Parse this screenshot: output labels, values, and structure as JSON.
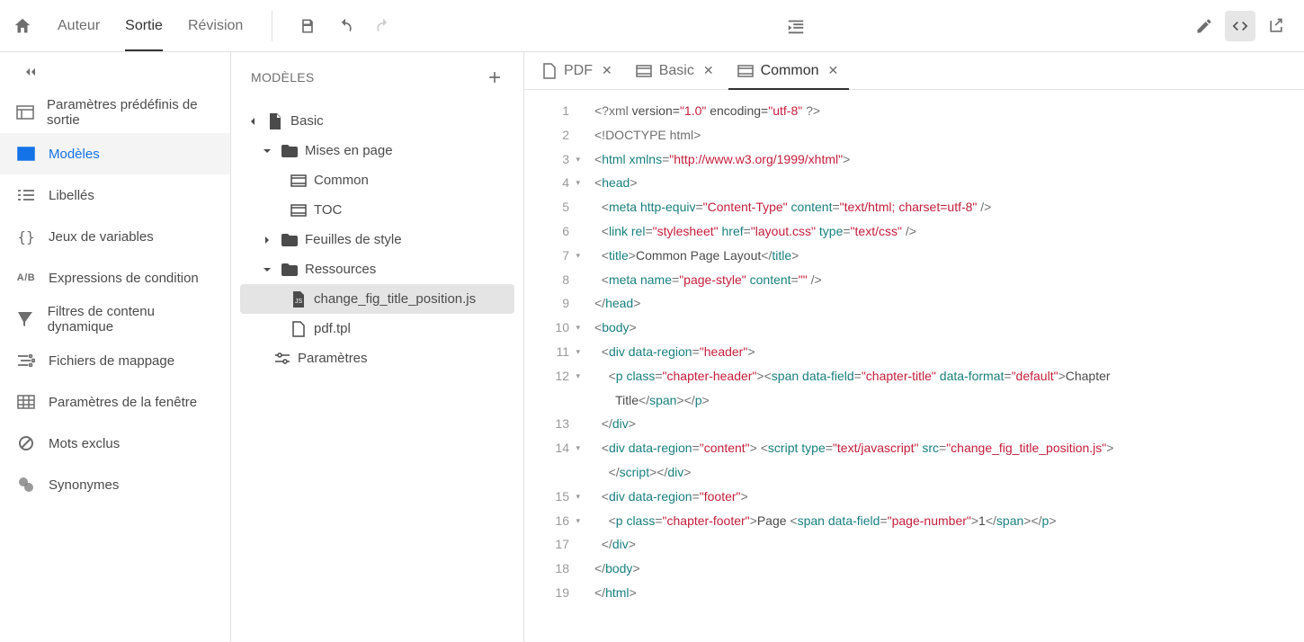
{
  "top": {
    "tabs": [
      "Auteur",
      "Sortie",
      "Révision"
    ],
    "active": 1
  },
  "leftnav": {
    "items": [
      "Paramètres prédéfinis de sortie",
      "Modèles",
      "Libellés",
      "Jeux de variables",
      "Expressions de condition",
      "Filtres de contenu dynamique",
      "Fichiers de mappage",
      "Paramètres de la fenêtre",
      "Mots exclus",
      "Synonymes"
    ],
    "active": 1
  },
  "treepanel": {
    "title": "MODÈLES"
  },
  "tree": {
    "root": "Basic",
    "layouts": {
      "label": "Mises en page",
      "items": [
        "Common",
        "TOC"
      ]
    },
    "styles": "Feuilles de style",
    "resources": {
      "label": "Ressources",
      "items": [
        "change_fig_title_position.js",
        "pdf.tpl"
      ],
      "selected": 0
    },
    "params": "Paramètres"
  },
  "editorTabs": [
    {
      "label": "PDF",
      "icon": "doc"
    },
    {
      "label": "Basic",
      "icon": "layout"
    },
    {
      "label": "Common",
      "icon": "layout",
      "active": true
    }
  ],
  "code": [
    {
      "n": 1,
      "tokens": [
        {
          "c": "pi",
          "t": "<?xml"
        },
        {
          "c": "t-txt",
          "t": " version="
        },
        {
          "c": "t-str",
          "t": "\"1.0\""
        },
        {
          "c": "t-txt",
          "t": " encoding="
        },
        {
          "c": "t-str",
          "t": "\"utf-8\""
        },
        {
          "c": "pi",
          "t": " ?>"
        }
      ]
    },
    {
      "n": 2,
      "tokens": [
        {
          "c": "pi",
          "t": "<!DOCTYPE html>"
        }
      ]
    },
    {
      "n": 3,
      "fold": true,
      "tokens": [
        {
          "c": "t-punc",
          "t": "<"
        },
        {
          "c": "t-tag",
          "t": "html"
        },
        {
          "c": "t-txt",
          "t": " "
        },
        {
          "c": "t-attr",
          "t": "xmlns"
        },
        {
          "c": "t-punc",
          "t": "="
        },
        {
          "c": "t-str",
          "t": "\"http://www.w3.org/1999/xhtml\""
        },
        {
          "c": "t-punc",
          "t": ">"
        }
      ]
    },
    {
      "n": 4,
      "fold": true,
      "tokens": [
        {
          "c": "t-punc",
          "t": "<"
        },
        {
          "c": "t-tag",
          "t": "head"
        },
        {
          "c": "t-punc",
          "t": ">"
        }
      ]
    },
    {
      "n": 5,
      "tokens": [
        {
          "c": "t-txt",
          "t": "  "
        },
        {
          "c": "t-punc",
          "t": "<"
        },
        {
          "c": "t-tag",
          "t": "meta"
        },
        {
          "c": "t-txt",
          "t": " "
        },
        {
          "c": "t-attr",
          "t": "http-equiv"
        },
        {
          "c": "t-punc",
          "t": "="
        },
        {
          "c": "t-str",
          "t": "\"Content-Type\""
        },
        {
          "c": "t-txt",
          "t": " "
        },
        {
          "c": "t-attr",
          "t": "content"
        },
        {
          "c": "t-punc",
          "t": "="
        },
        {
          "c": "t-str",
          "t": "\"text/html; charset=utf-8\""
        },
        {
          "c": "t-punc",
          "t": " />"
        }
      ]
    },
    {
      "n": 6,
      "tokens": [
        {
          "c": "t-txt",
          "t": "  "
        },
        {
          "c": "t-punc",
          "t": "<"
        },
        {
          "c": "t-tag",
          "t": "link"
        },
        {
          "c": "t-txt",
          "t": " "
        },
        {
          "c": "t-attr",
          "t": "rel"
        },
        {
          "c": "t-punc",
          "t": "="
        },
        {
          "c": "t-str",
          "t": "\"stylesheet\""
        },
        {
          "c": "t-txt",
          "t": " "
        },
        {
          "c": "t-attr",
          "t": "href"
        },
        {
          "c": "t-punc",
          "t": "="
        },
        {
          "c": "t-str",
          "t": "\"layout.css\""
        },
        {
          "c": "t-txt",
          "t": " "
        },
        {
          "c": "t-attr",
          "t": "type"
        },
        {
          "c": "t-punc",
          "t": "="
        },
        {
          "c": "t-str",
          "t": "\"text/css\""
        },
        {
          "c": "t-punc",
          "t": " />"
        }
      ]
    },
    {
      "n": 7,
      "fold": true,
      "tokens": [
        {
          "c": "t-txt",
          "t": "  "
        },
        {
          "c": "t-punc",
          "t": "<"
        },
        {
          "c": "t-tag",
          "t": "title"
        },
        {
          "c": "t-punc",
          "t": ">"
        },
        {
          "c": "t-txt",
          "t": "Common Page Layout"
        },
        {
          "c": "t-punc",
          "t": "</"
        },
        {
          "c": "t-tag",
          "t": "title"
        },
        {
          "c": "t-punc",
          "t": ">"
        }
      ]
    },
    {
      "n": 8,
      "tokens": [
        {
          "c": "t-txt",
          "t": "  "
        },
        {
          "c": "t-punc",
          "t": "<"
        },
        {
          "c": "t-tag",
          "t": "meta"
        },
        {
          "c": "t-txt",
          "t": " "
        },
        {
          "c": "t-attr",
          "t": "name"
        },
        {
          "c": "t-punc",
          "t": "="
        },
        {
          "c": "t-str",
          "t": "\"page-style\""
        },
        {
          "c": "t-txt",
          "t": " "
        },
        {
          "c": "t-attr",
          "t": "content"
        },
        {
          "c": "t-punc",
          "t": "="
        },
        {
          "c": "t-str",
          "t": "\"\""
        },
        {
          "c": "t-punc",
          "t": " />"
        }
      ]
    },
    {
      "n": 9,
      "tokens": [
        {
          "c": "t-punc",
          "t": "</"
        },
        {
          "c": "t-tag",
          "t": "head"
        },
        {
          "c": "t-punc",
          "t": ">"
        }
      ]
    },
    {
      "n": 10,
      "fold": true,
      "tokens": [
        {
          "c": "t-punc",
          "t": "<"
        },
        {
          "c": "t-tag",
          "t": "body"
        },
        {
          "c": "t-punc",
          "t": ">"
        }
      ]
    },
    {
      "n": 11,
      "fold": true,
      "tokens": [
        {
          "c": "t-txt",
          "t": "  "
        },
        {
          "c": "t-punc",
          "t": "<"
        },
        {
          "c": "t-tag",
          "t": "div"
        },
        {
          "c": "t-txt",
          "t": " "
        },
        {
          "c": "t-attr",
          "t": "data-region"
        },
        {
          "c": "t-punc",
          "t": "="
        },
        {
          "c": "t-str",
          "t": "\"header\""
        },
        {
          "c": "t-punc",
          "t": ">"
        }
      ]
    },
    {
      "n": 12,
      "fold": true,
      "tokens": [
        {
          "c": "t-txt",
          "t": "    "
        },
        {
          "c": "t-punc",
          "t": "<"
        },
        {
          "c": "t-tag",
          "t": "p"
        },
        {
          "c": "t-txt",
          "t": " "
        },
        {
          "c": "t-attr",
          "t": "class"
        },
        {
          "c": "t-punc",
          "t": "="
        },
        {
          "c": "t-str",
          "t": "\"chapter-header\""
        },
        {
          "c": "t-punc",
          "t": "><"
        },
        {
          "c": "t-tag",
          "t": "span"
        },
        {
          "c": "t-txt",
          "t": " "
        },
        {
          "c": "t-attr",
          "t": "data-field"
        },
        {
          "c": "t-punc",
          "t": "="
        },
        {
          "c": "t-str",
          "t": "\"chapter-title\""
        },
        {
          "c": "t-txt",
          "t": " "
        },
        {
          "c": "t-attr",
          "t": "data-format"
        },
        {
          "c": "t-punc",
          "t": "="
        },
        {
          "c": "t-str",
          "t": "\"default\""
        },
        {
          "c": "t-punc",
          "t": ">"
        },
        {
          "c": "t-txt",
          "t": "Chapter\n      Title"
        },
        {
          "c": "t-punc",
          "t": "</"
        },
        {
          "c": "t-tag",
          "t": "span"
        },
        {
          "c": "t-punc",
          "t": "></"
        },
        {
          "c": "t-tag",
          "t": "p"
        },
        {
          "c": "t-punc",
          "t": ">"
        }
      ]
    },
    {
      "n": 13,
      "tokens": [
        {
          "c": "t-txt",
          "t": "  "
        },
        {
          "c": "t-punc",
          "t": "</"
        },
        {
          "c": "t-tag",
          "t": "div"
        },
        {
          "c": "t-punc",
          "t": ">"
        }
      ]
    },
    {
      "n": 14,
      "fold": true,
      "tokens": [
        {
          "c": "t-txt",
          "t": "  "
        },
        {
          "c": "t-punc",
          "t": "<"
        },
        {
          "c": "t-tag",
          "t": "div"
        },
        {
          "c": "t-txt",
          "t": " "
        },
        {
          "c": "t-attr",
          "t": "data-region"
        },
        {
          "c": "t-punc",
          "t": "="
        },
        {
          "c": "t-str",
          "t": "\"content\""
        },
        {
          "c": "t-punc",
          "t": ">"
        },
        {
          "c": "t-txt",
          "t": " "
        },
        {
          "c": "t-punc",
          "t": "<"
        },
        {
          "c": "t-tag",
          "t": "script"
        },
        {
          "c": "t-txt",
          "t": " "
        },
        {
          "c": "t-attr",
          "t": "type"
        },
        {
          "c": "t-punc",
          "t": "="
        },
        {
          "c": "t-str",
          "t": "\"text/javascript\""
        },
        {
          "c": "t-txt",
          "t": " "
        },
        {
          "c": "t-attr",
          "t": "src"
        },
        {
          "c": "t-punc",
          "t": "="
        },
        {
          "c": "t-str",
          "t": "\"change_fig_title_position.js\""
        },
        {
          "c": "t-punc",
          "t": ">"
        },
        {
          "c": "t-txt",
          "t": "\n    "
        },
        {
          "c": "t-punc",
          "t": "</"
        },
        {
          "c": "t-tag",
          "t": "script"
        },
        {
          "c": "t-punc",
          "t": "></"
        },
        {
          "c": "t-tag",
          "t": "div"
        },
        {
          "c": "t-punc",
          "t": ">"
        }
      ]
    },
    {
      "n": 15,
      "fold": true,
      "tokens": [
        {
          "c": "t-txt",
          "t": "  "
        },
        {
          "c": "t-punc",
          "t": "<"
        },
        {
          "c": "t-tag",
          "t": "div"
        },
        {
          "c": "t-txt",
          "t": " "
        },
        {
          "c": "t-attr",
          "t": "data-region"
        },
        {
          "c": "t-punc",
          "t": "="
        },
        {
          "c": "t-str",
          "t": "\"footer\""
        },
        {
          "c": "t-punc",
          "t": ">"
        }
      ]
    },
    {
      "n": 16,
      "fold": true,
      "tokens": [
        {
          "c": "t-txt",
          "t": "    "
        },
        {
          "c": "t-punc",
          "t": "<"
        },
        {
          "c": "t-tag",
          "t": "p"
        },
        {
          "c": "t-txt",
          "t": " "
        },
        {
          "c": "t-attr",
          "t": "class"
        },
        {
          "c": "t-punc",
          "t": "="
        },
        {
          "c": "t-str",
          "t": "\"chapter-footer\""
        },
        {
          "c": "t-punc",
          "t": ">"
        },
        {
          "c": "t-txt",
          "t": "Page "
        },
        {
          "c": "t-punc",
          "t": "<"
        },
        {
          "c": "t-tag",
          "t": "span"
        },
        {
          "c": "t-txt",
          "t": " "
        },
        {
          "c": "t-attr",
          "t": "data-field"
        },
        {
          "c": "t-punc",
          "t": "="
        },
        {
          "c": "t-str",
          "t": "\"page-number\""
        },
        {
          "c": "t-punc",
          "t": ">"
        },
        {
          "c": "t-txt",
          "t": "1"
        },
        {
          "c": "t-punc",
          "t": "</"
        },
        {
          "c": "t-tag",
          "t": "span"
        },
        {
          "c": "t-punc",
          "t": "></"
        },
        {
          "c": "t-tag",
          "t": "p"
        },
        {
          "c": "t-punc",
          "t": ">"
        }
      ]
    },
    {
      "n": 17,
      "tokens": [
        {
          "c": "t-txt",
          "t": "  "
        },
        {
          "c": "t-punc",
          "t": "</"
        },
        {
          "c": "t-tag",
          "t": "div"
        },
        {
          "c": "t-punc",
          "t": ">"
        }
      ]
    },
    {
      "n": 18,
      "tokens": [
        {
          "c": "t-punc",
          "t": "</"
        },
        {
          "c": "t-tag",
          "t": "body"
        },
        {
          "c": "t-punc",
          "t": ">"
        }
      ]
    },
    {
      "n": 19,
      "tokens": [
        {
          "c": "t-punc",
          "t": "</"
        },
        {
          "c": "t-tag",
          "t": "html"
        },
        {
          "c": "t-punc",
          "t": ">"
        }
      ]
    }
  ]
}
